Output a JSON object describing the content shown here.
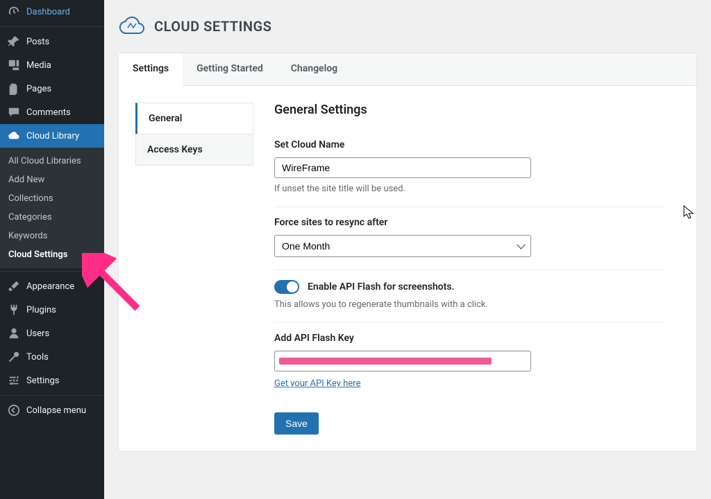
{
  "sidebar": {
    "items": [
      {
        "id": "dashboard",
        "label": "Dashboard",
        "icon": "dashboard-icon"
      },
      {
        "id": "posts",
        "label": "Posts",
        "icon": "pin-icon"
      },
      {
        "id": "media",
        "label": "Media",
        "icon": "media-icon"
      },
      {
        "id": "pages",
        "label": "Pages",
        "icon": "pages-icon"
      },
      {
        "id": "comments",
        "label": "Comments",
        "icon": "comment-icon"
      },
      {
        "id": "cloud-library",
        "label": "Cloud Library",
        "icon": "cloud-icon",
        "active": true
      },
      {
        "id": "appearance",
        "label": "Appearance",
        "icon": "brush-icon"
      },
      {
        "id": "plugins",
        "label": "Plugins",
        "icon": "plug-icon"
      },
      {
        "id": "users",
        "label": "Users",
        "icon": "user-icon"
      },
      {
        "id": "tools",
        "label": "Tools",
        "icon": "wrench-icon"
      },
      {
        "id": "settings",
        "label": "Settings",
        "icon": "sliders-icon"
      },
      {
        "id": "collapse",
        "label": "Collapse menu",
        "icon": "collapse-icon"
      }
    ],
    "submenu": [
      {
        "label": "All Cloud Libraries"
      },
      {
        "label": "Add New"
      },
      {
        "label": "Collections"
      },
      {
        "label": "Categories"
      },
      {
        "label": "Keywords"
      },
      {
        "label": "Cloud Settings",
        "current": true
      }
    ]
  },
  "header": {
    "title": "CLOUD SETTINGS"
  },
  "tabs": [
    {
      "label": "Settings",
      "active": true
    },
    {
      "label": "Getting Started"
    },
    {
      "label": "Changelog"
    }
  ],
  "side_nav": [
    {
      "label": "General",
      "active": true
    },
    {
      "label": "Access Keys"
    }
  ],
  "settings": {
    "heading": "General Settings",
    "cloud_name": {
      "label": "Set Cloud Name",
      "value": "WireFrame",
      "helper": "If unset the site title will be used."
    },
    "resync": {
      "label": "Force sites to resync after",
      "value": "One Month"
    },
    "api_flash": {
      "toggle_label": "Enable API Flash for screenshots.",
      "helper": "This allows you to regenerate thumbnails with a click."
    },
    "api_key": {
      "label": "Add API Flash Key",
      "link": "Get your API Key here"
    },
    "save": "Save"
  }
}
